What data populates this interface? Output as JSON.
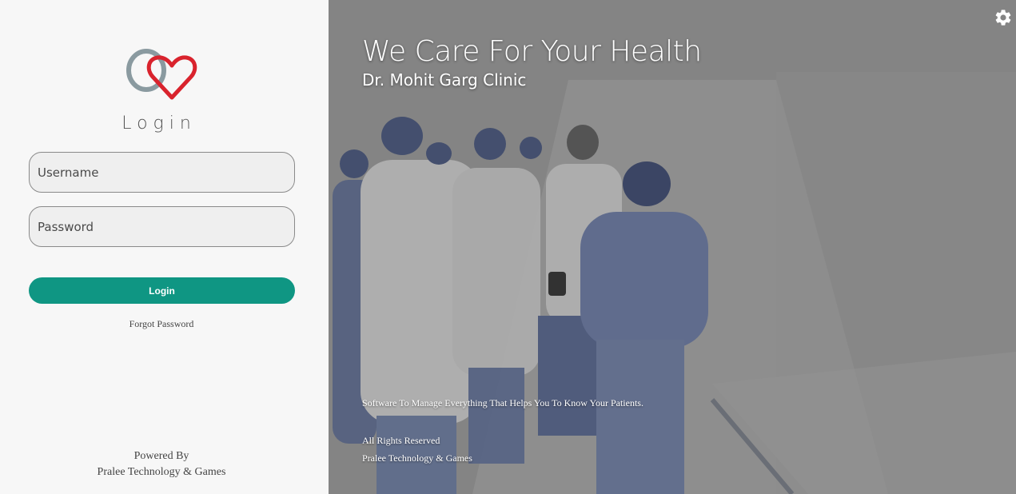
{
  "login_panel": {
    "title": "Login",
    "username_placeholder": "Username",
    "password_placeholder": "Password",
    "login_button": "Login",
    "forgot_password": "Forgot Password",
    "powered_by": "Powered By",
    "company": "Pralee Technology & Games"
  },
  "hero": {
    "title": "We Care For Your Health",
    "subtitle": "Dr. Mohit Garg Clinic",
    "tagline": "Software To Manage Everything That Helps You To Know Your Patients.",
    "rights": "All Rights Reserved",
    "company": "Pralee Technology & Games"
  },
  "icons": {
    "logo": "heart-logo-icon",
    "settings": "gear-icon"
  },
  "colors": {
    "accent": "#0f9683",
    "heart_red": "#d9232d",
    "heart_gray": "#8a9aa0"
  }
}
